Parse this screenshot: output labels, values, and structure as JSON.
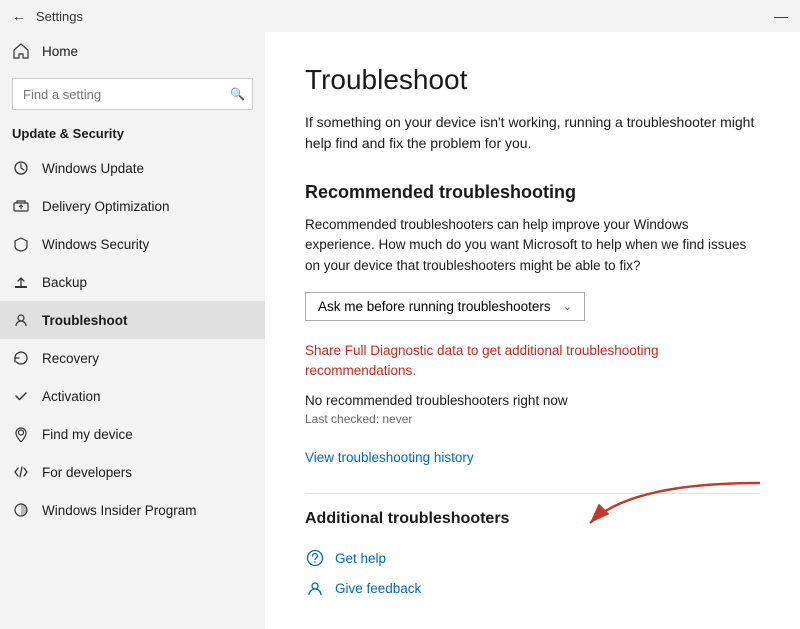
{
  "titlebar": {
    "title": "Settings",
    "minimize_label": "—"
  },
  "sidebar": {
    "home_label": "Home",
    "search_placeholder": "Find a setting",
    "section_label": "Update & Security",
    "items": [
      {
        "id": "windows-update",
        "label": "Windows Update",
        "icon": "↻"
      },
      {
        "id": "delivery-optimization",
        "label": "Delivery Optimization",
        "icon": "⬆"
      },
      {
        "id": "windows-security",
        "label": "Windows Security",
        "icon": "🛡"
      },
      {
        "id": "backup",
        "label": "Backup",
        "icon": "↑"
      },
      {
        "id": "troubleshoot",
        "label": "Troubleshoot",
        "icon": "👤"
      },
      {
        "id": "recovery",
        "label": "Recovery",
        "icon": "↩"
      },
      {
        "id": "activation",
        "label": "Activation",
        "icon": "✓"
      },
      {
        "id": "find-my-device",
        "label": "Find my device",
        "icon": "📍"
      },
      {
        "id": "for-developers",
        "label": "For developers",
        "icon": "⚙"
      },
      {
        "id": "windows-insider",
        "label": "Windows Insider Program",
        "icon": "◑"
      }
    ]
  },
  "content": {
    "page_title": "Troubleshoot",
    "page_description": "If something on your device isn't working, running a troubleshooter might help find and fix the problem for you.",
    "recommended_section": {
      "title": "Recommended troubleshooting",
      "description": "Recommended troubleshooters can help improve your Windows experience. How much do you want Microsoft to help when we find issues on your device that troubleshooters might be able to fix?",
      "dropdown_value": "Ask me before running troubleshooters",
      "diagnostic_link_text": "Share Full Diagnostic data to get additional troubleshooting recommendations.",
      "no_troubleshooters_text": "No recommended troubleshooters right now",
      "last_checked": "Last checked: never"
    },
    "view_history_label": "View troubleshooting history",
    "additional_section": {
      "title": "Additional troubleshooters"
    },
    "actions": [
      {
        "id": "get-help",
        "label": "Get help",
        "icon": "?"
      },
      {
        "id": "give-feedback",
        "label": "Give feedback",
        "icon": "👤"
      }
    ]
  }
}
